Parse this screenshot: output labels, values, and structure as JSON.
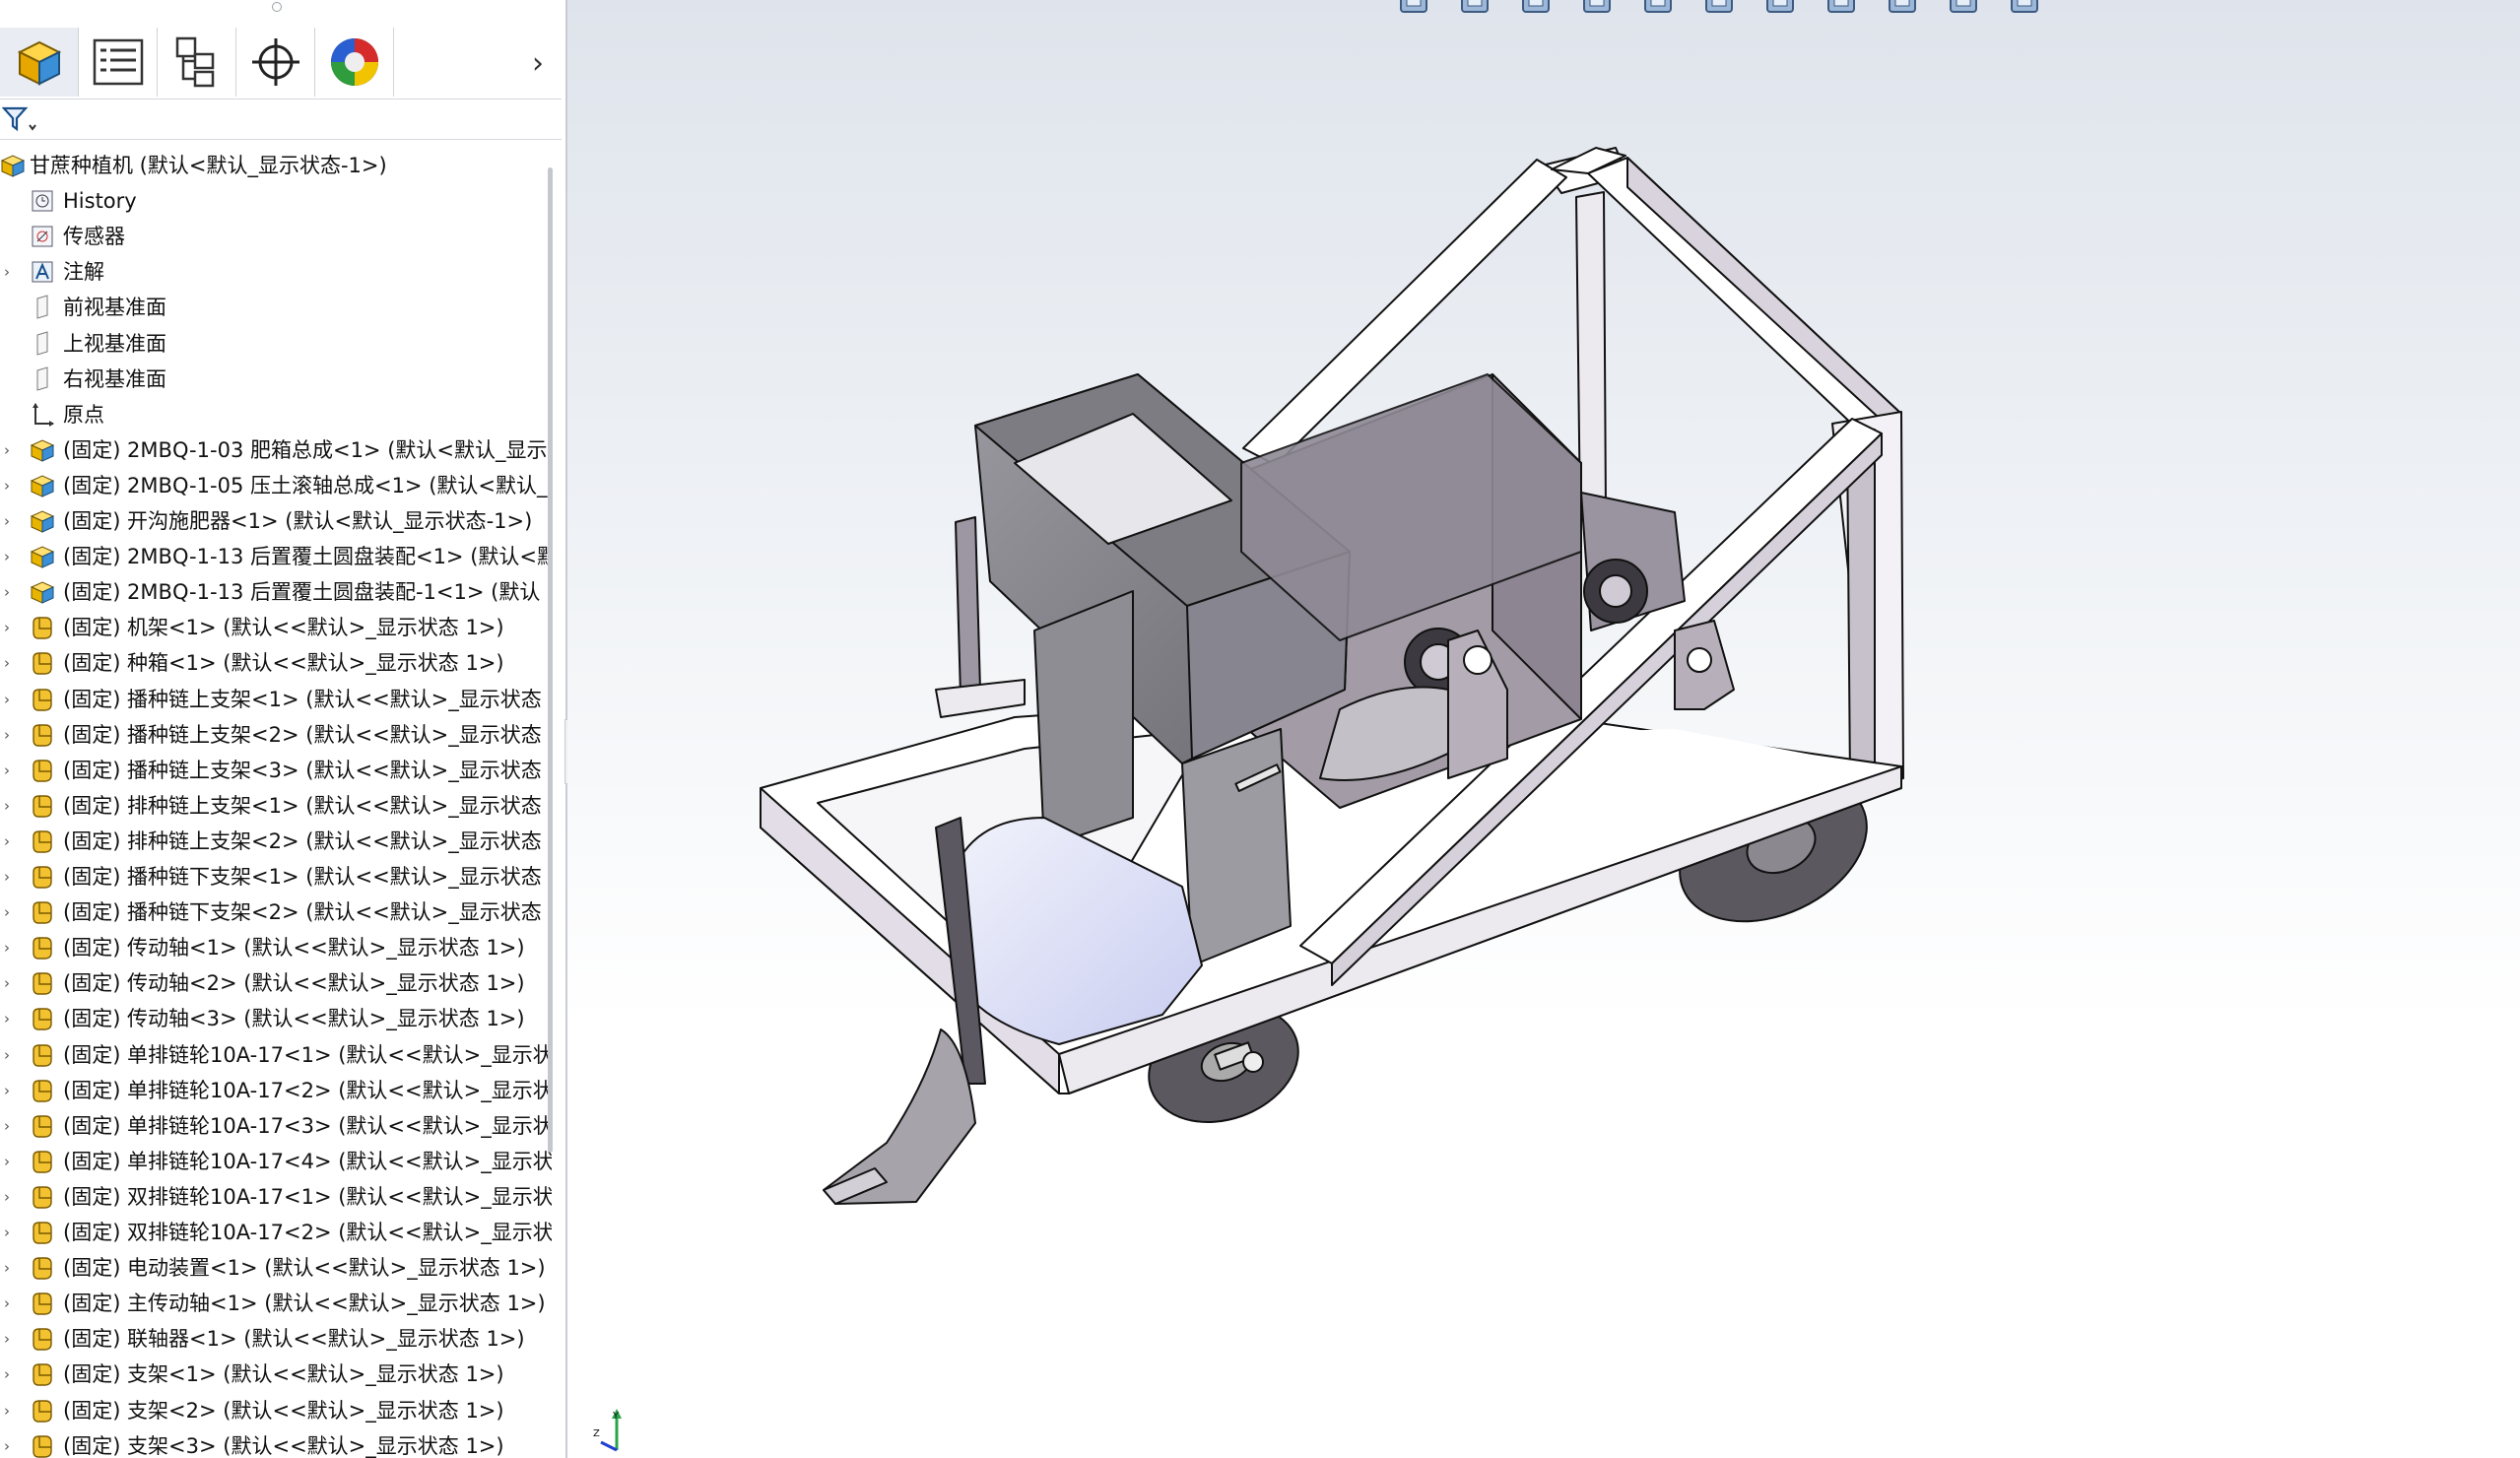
{
  "feature_manager": {
    "tabs": [
      {
        "name": "FeatureManager 设计树",
        "icon": "part-cube-icon"
      },
      {
        "name": "PropertyManager",
        "icon": "property-list-icon"
      },
      {
        "name": "ConfigurationManager",
        "icon": "configuration-tree-icon"
      },
      {
        "name": "DimXpertManager",
        "icon": "crosshair-target-icon"
      },
      {
        "name": "DisplayManager",
        "icon": "color-sphere-icon"
      }
    ],
    "tab_scroll_glyph": "›",
    "filter_icon": "funnel-filter-icon",
    "root": {
      "label": "甘蔗种植机 (默认<默认_显示状态-1>)",
      "icon": "assembly-icon"
    },
    "fixed_items": [
      {
        "label": "History",
        "icon": "history-icon",
        "expandable": false
      },
      {
        "label": "传感器",
        "icon": "sensor-icon",
        "expandable": false
      },
      {
        "label": "注解",
        "icon": "annotation-icon",
        "expandable": true
      },
      {
        "label": "前视基准面",
        "icon": "plane-icon",
        "expandable": false
      },
      {
        "label": "上视基准面",
        "icon": "plane-icon",
        "expandable": false
      },
      {
        "label": "右视基准面",
        "icon": "plane-icon",
        "expandable": false
      },
      {
        "label": "原点",
        "icon": "origin-icon",
        "expandable": false
      }
    ],
    "components": [
      {
        "label": "(固定) 2MBQ-1-03 肥箱总成<1> (默认<默认_显示",
        "icon": "subassembly-icon"
      },
      {
        "label": "(固定) 2MBQ-1-05 压土滚轴总成<1> (默认<默认_",
        "icon": "subassembly-icon"
      },
      {
        "label": "(固定) 开沟施肥器<1> (默认<默认_显示状态-1>)",
        "icon": "subassembly-icon"
      },
      {
        "label": "(固定) 2MBQ-1-13 后置覆土圆盘装配<1> (默认<默",
        "icon": "subassembly-icon"
      },
      {
        "label": "(固定) 2MBQ-1-13 后置覆土圆盘装配-1<1> (默认",
        "icon": "subassembly-icon"
      },
      {
        "label": "(固定) 机架<1> (默认<<默认>_显示状态 1>)",
        "icon": "part-icon"
      },
      {
        "label": "(固定) 种箱<1> (默认<<默认>_显示状态 1>)",
        "icon": "part-icon"
      },
      {
        "label": "(固定) 播种链上支架<1> (默认<<默认>_显示状态",
        "icon": "part-icon"
      },
      {
        "label": "(固定) 播种链上支架<2> (默认<<默认>_显示状态",
        "icon": "part-icon"
      },
      {
        "label": "(固定) 播种链上支架<3> (默认<<默认>_显示状态",
        "icon": "part-icon"
      },
      {
        "label": "(固定) 排种链上支架<1> (默认<<默认>_显示状态",
        "icon": "part-icon"
      },
      {
        "label": "(固定) 排种链上支架<2> (默认<<默认>_显示状态",
        "icon": "part-icon"
      },
      {
        "label": "(固定) 播种链下支架<1> (默认<<默认>_显示状态",
        "icon": "part-icon"
      },
      {
        "label": "(固定) 播种链下支架<2> (默认<<默认>_显示状态",
        "icon": "part-icon"
      },
      {
        "label": "(固定) 传动轴<1> (默认<<默认>_显示状态 1>)",
        "icon": "part-icon"
      },
      {
        "label": "(固定) 传动轴<2> (默认<<默认>_显示状态 1>)",
        "icon": "part-icon"
      },
      {
        "label": "(固定) 传动轴<3> (默认<<默认>_显示状态 1>)",
        "icon": "part-icon"
      },
      {
        "label": "(固定) 单排链轮10A-17<1> (默认<<默认>_显示状",
        "icon": "part-icon"
      },
      {
        "label": "(固定) 单排链轮10A-17<2> (默认<<默认>_显示状",
        "icon": "part-icon"
      },
      {
        "label": "(固定) 单排链轮10A-17<3> (默认<<默认>_显示状",
        "icon": "part-icon"
      },
      {
        "label": "(固定) 单排链轮10A-17<4> (默认<<默认>_显示状",
        "icon": "part-icon"
      },
      {
        "label": "(固定) 双排链轮10A-17<1> (默认<<默认>_显示状",
        "icon": "part-icon"
      },
      {
        "label": "(固定) 双排链轮10A-17<2> (默认<<默认>_显示状",
        "icon": "part-icon"
      },
      {
        "label": "(固定) 电动装置<1> (默认<<默认>_显示状态 1>)",
        "icon": "part-icon"
      },
      {
        "label": "(固定) 主传动轴<1> (默认<<默认>_显示状态 1>)",
        "icon": "part-icon"
      },
      {
        "label": "(固定) 联轴器<1> (默认<<默认>_显示状态 1>)",
        "icon": "part-icon"
      },
      {
        "label": "(固定) 支架<1> (默认<<默认>_显示状态 1>)",
        "icon": "part-icon"
      },
      {
        "label": "(固定) 支架<2> (默认<<默认>_显示状态 1>)",
        "icon": "part-icon"
      },
      {
        "label": "(固定) 支架<3> (默认<<默认>_显示状态 1>)",
        "icon": "part-icon"
      }
    ]
  },
  "graphics_area": {
    "model": "sugarcane-planter-assembly-3d-view",
    "heads_up_icons": [
      "zoom-to-fit-icon",
      "zoom-area-icon",
      "previous-view-icon",
      "section-view-icon",
      "dynamic-annotation-icon",
      "view-orientation-icon",
      "display-style-icon",
      "hide-show-items-icon",
      "edit-appearance-icon",
      "apply-scene-icon",
      "view-settings-icon"
    ],
    "triad_labels": {
      "z": "Z",
      "y": "Y"
    }
  },
  "colors": {
    "assembly_icon": "#e8b400",
    "part_icon": "#f2c230",
    "frame_metal": "#a59aa6",
    "hopper_metal": "#8b8a8f",
    "background_top": "#dfe4ec"
  }
}
